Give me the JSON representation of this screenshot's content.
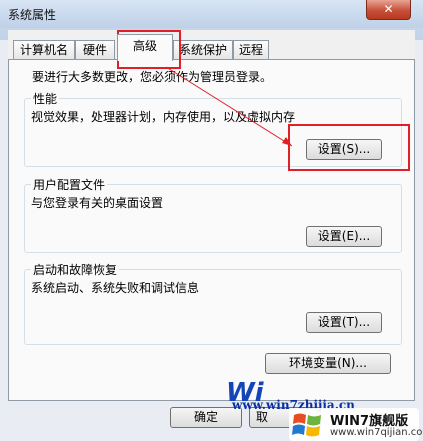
{
  "window": {
    "title": "系统属性",
    "close_label": "✕"
  },
  "tabs": [
    {
      "label": "计算机名"
    },
    {
      "label": "硬件"
    },
    {
      "label": "高级"
    },
    {
      "label": "系统保护"
    },
    {
      "label": "远程"
    }
  ],
  "advanced": {
    "admin_note": "要进行大多数更改，您必须作为管理员登录。",
    "performance": {
      "title": "性能",
      "desc": "视觉效果，处理器计划，内存使用，以及虚拟内存",
      "button": "设置(S)..."
    },
    "profiles": {
      "title": "用户配置文件",
      "desc": "与您登录有关的桌面设置",
      "button": "设置(E)..."
    },
    "startup": {
      "title": "启动和故障恢复",
      "desc": "系统启动、系统失败和调试信息",
      "button": "设置(T)..."
    },
    "env_button": "环境变量(N)..."
  },
  "footer": {
    "ok": "确定",
    "partial": "取"
  },
  "watermark": {
    "win_text": "Wi",
    "url": "www.win7zhijia.cn",
    "brand_name": "WIN7旗舰版",
    "brand_url": "www.win7qijian.com"
  },
  "colors": {
    "annotation": "#e01f26",
    "brand": "#1445b8"
  }
}
